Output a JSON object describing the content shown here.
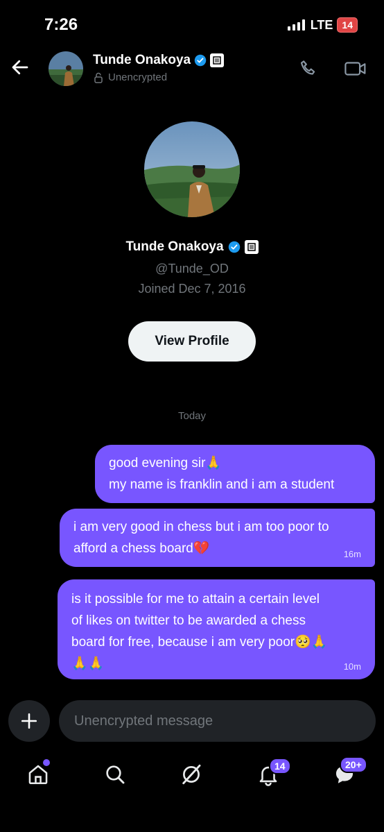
{
  "status_bar": {
    "time": "7:26",
    "network": "LTE",
    "battery": "14"
  },
  "header": {
    "name": "Tunde Onakoya",
    "encryption": "Unencrypted"
  },
  "profile": {
    "name": "Tunde Onakoya",
    "handle": "@Tunde_OD",
    "joined": "Joined Dec 7, 2016",
    "view_profile_label": "View Profile"
  },
  "conversation": {
    "date_separator": "Today",
    "messages": [
      {
        "lines": [
          "good evening sir🙏",
          "my name is franklin and i am a student"
        ],
        "time": ""
      },
      {
        "lines": [
          "i am very good in chess but i am too poor to",
          "afford a chess board💔"
        ],
        "time": "16m"
      },
      {
        "lines": [
          "is it possible for me to attain a certain level",
          "of likes on twitter to be awarded a chess",
          "board for free, because i am very poor🥺🙏",
          "🙏🙏"
        ],
        "time": "10m"
      }
    ]
  },
  "composer": {
    "placeholder": "Unencrypted message"
  },
  "bottom_nav": {
    "items": [
      "home-icon",
      "search-icon",
      "grok-icon",
      "notifications-icon",
      "messages-icon"
    ],
    "notifications_badge": "14",
    "messages_badge": "20+"
  },
  "colors": {
    "accent": "#7856ff",
    "background": "#000000",
    "verified": "#1d9bf0"
  }
}
